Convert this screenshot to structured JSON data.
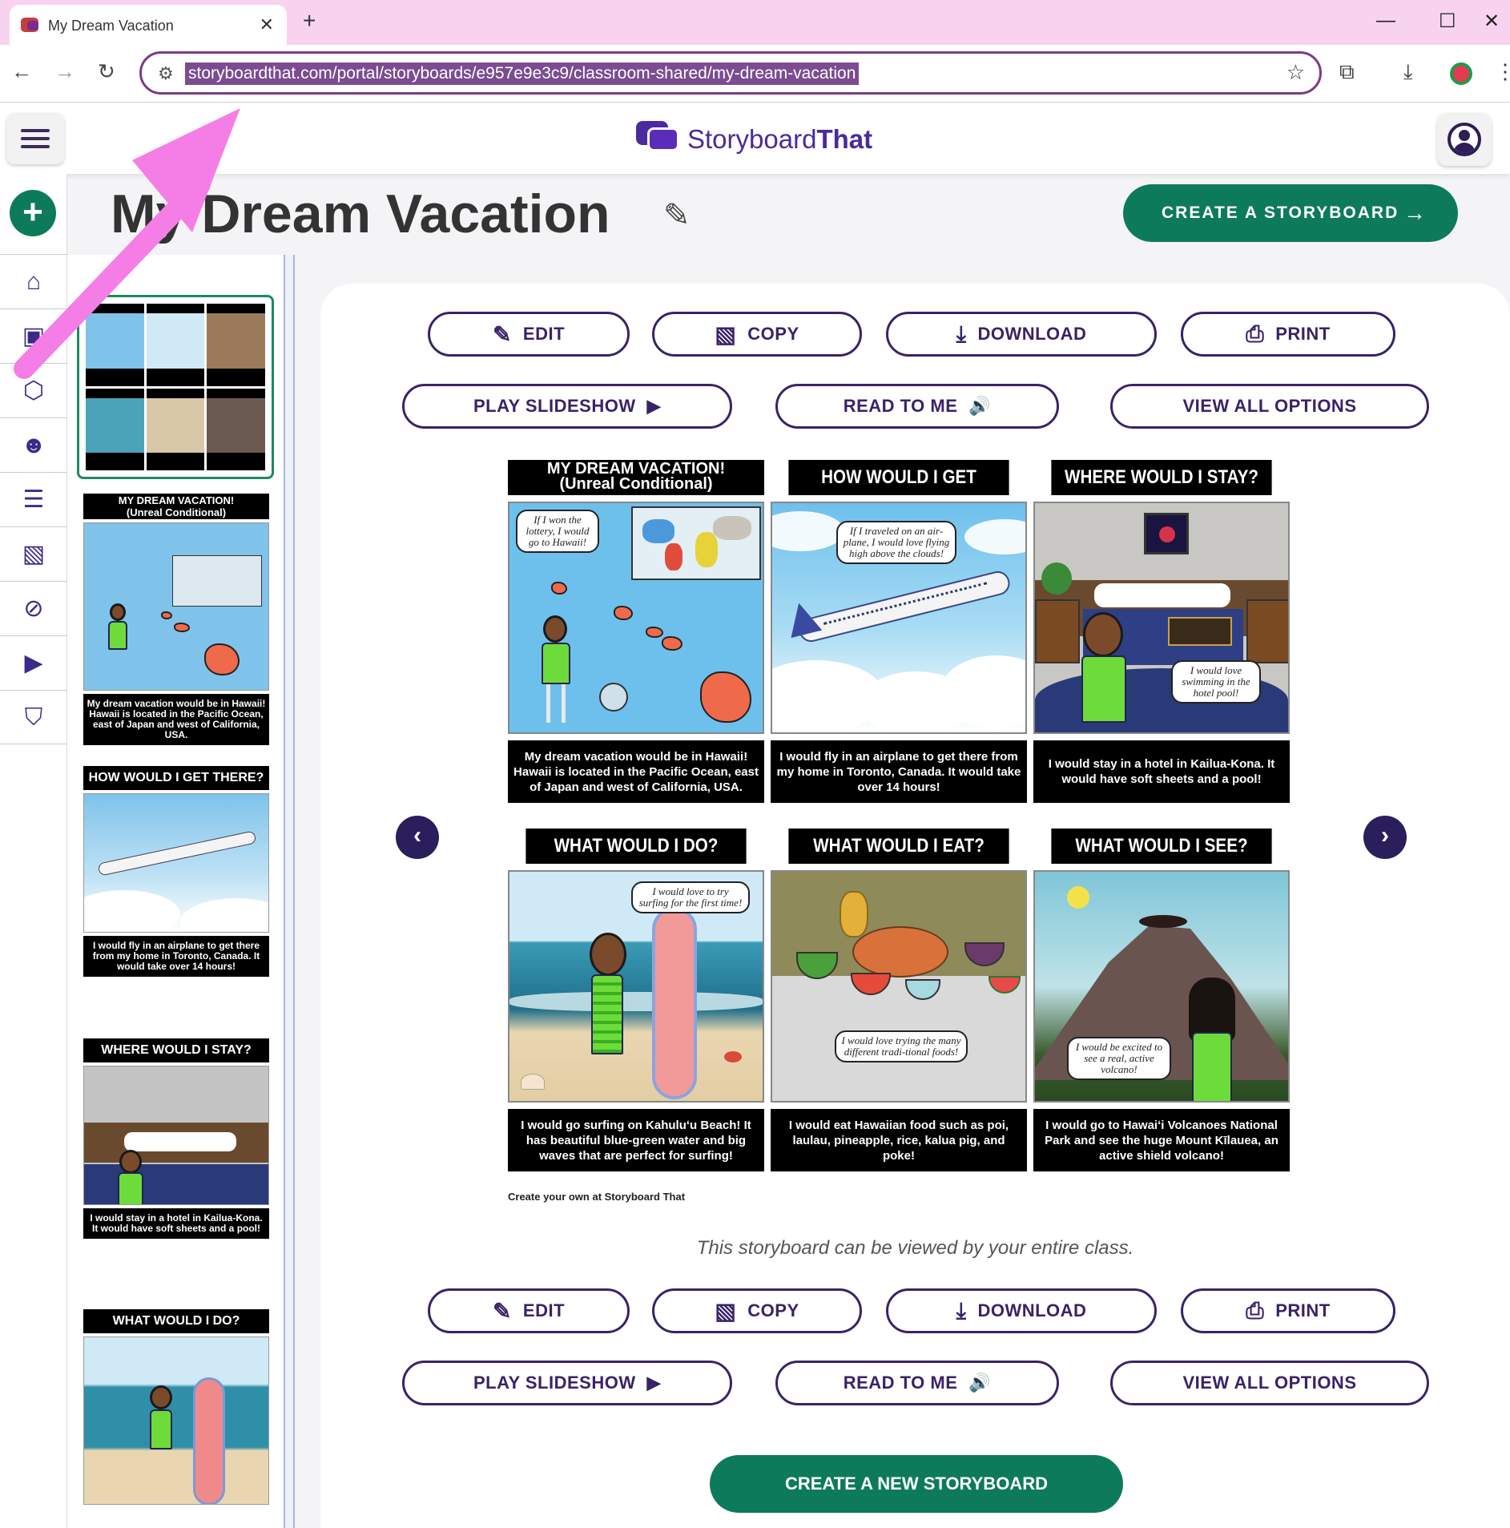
{
  "browser": {
    "tab_title": "My Dream Vacation",
    "tab_close": "✕",
    "new_tab": "+",
    "url": "storyboardthat.com/portal/storyboards/e957e9e3c9/classroom-shared/my-dream-vacation",
    "window": {
      "minimize": "—",
      "maximize": "☐",
      "close": "✕"
    }
  },
  "app": {
    "logo_text_light": "Storyboard",
    "logo_text_bold": "That"
  },
  "page": {
    "title": "My Dream Vacation",
    "create_storyboard": "CREATE A STORYBOARD",
    "create_arrow": "→",
    "share_note": "This storyboard can be viewed by your entire class.",
    "credit": "Create your own at Storyboard That",
    "create_new": "CREATE A NEW STORYBOARD"
  },
  "actions": {
    "edit": "EDIT",
    "copy": "COPY",
    "download": "DOWNLOAD",
    "print": "PRINT",
    "play_slideshow": "PLAY SLIDESHOW",
    "read_to_me": "READ TO ME",
    "view_all_options": "VIEW ALL OPTIONS",
    "prev": "‹",
    "next": "›"
  },
  "cells": [
    {
      "title_line1": "MY DREAM VACATION!",
      "title_line2": "(Unreal Conditional)",
      "bubble": "If I won the lottery, I would go to Hawaii!",
      "caption": "My dream vacation would be in Hawaii! Hawaii is located in the Pacific Ocean, east of Japan and west of California, USA."
    },
    {
      "title": "HOW WOULD I GET THERE?",
      "bubble": "If I traveled on an air-plane, I would love flying high above the clouds!",
      "caption": "I would fly in an airplane to get there from my home in Toronto, Canada. It would take over 14 hours!"
    },
    {
      "title": "WHERE WOULD I STAY?",
      "bubble": "I would love swimming in the hotel pool!",
      "caption": "I would stay in a hotel in Kailua-Kona. It would have soft sheets and a pool!"
    },
    {
      "title": "WHAT WOULD I DO?",
      "bubble": "I would love to try surfing for the first time!",
      "caption": "I would go surfing on Kahuluʻu Beach! It has beautiful blue-green water and big waves that are perfect for surfing!"
    },
    {
      "title": "WHAT WOULD I EAT?",
      "bubble": "I would love trying the many different tradi-tional foods!",
      "caption": "I would eat Hawaiian food such as poi, laulau, pineapple, rice, kalua pig, and poke!"
    },
    {
      "title": "WHAT WOULD I SEE?",
      "bubble": "I would be excited to see a real, active volcano!",
      "caption": "I would go to Hawaiʻi Volcanoes National Park and see the huge Mount Kīlauea, an active shield volcano!"
    }
  ],
  "colors": {
    "brand_purple": "#3a2268",
    "brand_green": "#0e7a5c",
    "annotation_pink": "#f47ee6",
    "tab_bar": "#f7d3ef"
  }
}
